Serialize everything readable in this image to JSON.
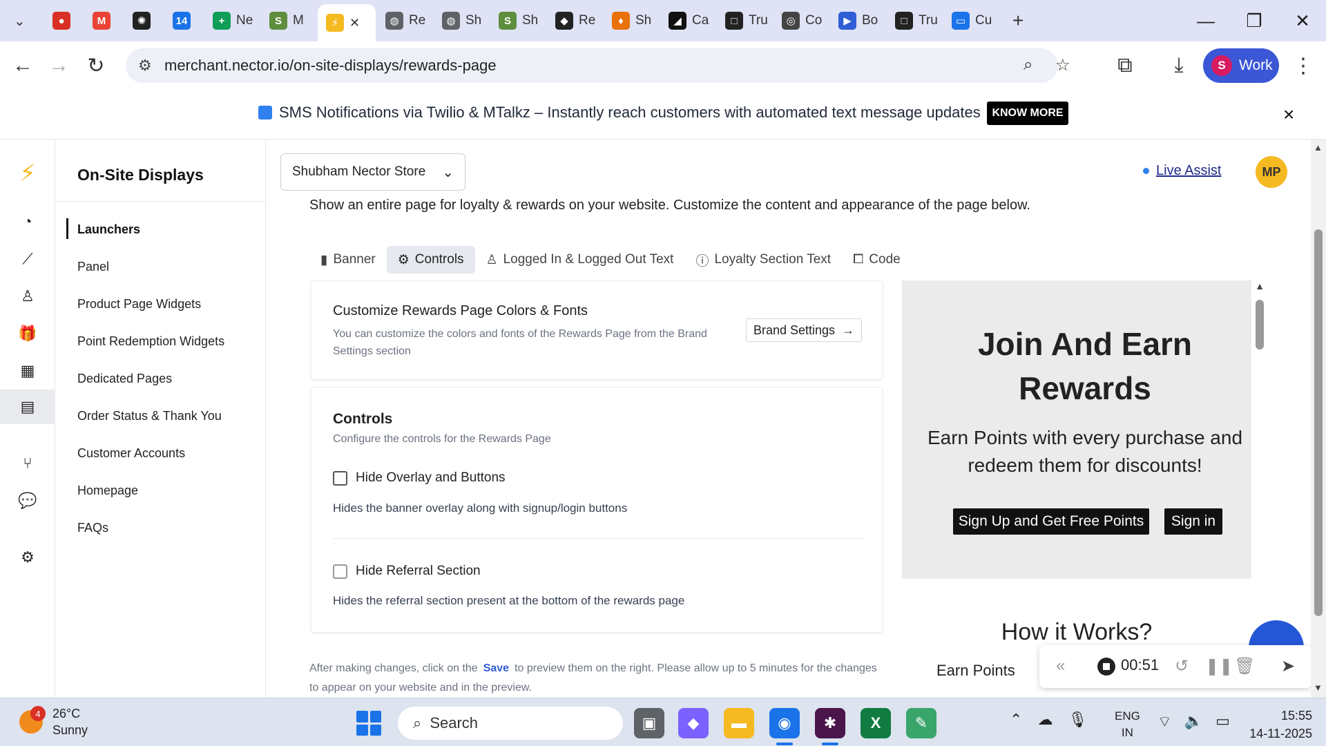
{
  "browser": {
    "tabs": [
      {
        "label": "",
        "icon": "record-icon",
        "color": "#d93025"
      },
      {
        "label": "",
        "icon": "gmail-icon",
        "color": "#ea4335"
      },
      {
        "label": "",
        "icon": "chatgpt-icon",
        "color": "#222222"
      },
      {
        "label": "",
        "icon": "calendar-icon",
        "color": "#1a73e8"
      },
      {
        "label": "Ne",
        "icon": "sheets-icon",
        "color": "#0f9d58"
      },
      {
        "label": "M",
        "icon": "shopify-icon",
        "color": "#5e8e3e"
      },
      {
        "label": "",
        "icon": "nector-icon",
        "color": "#f5b921"
      },
      {
        "label": "Re",
        "icon": "globe-icon",
        "color": "#5f6368"
      },
      {
        "label": "Sh",
        "icon": "globe-icon",
        "color": "#5f6368"
      },
      {
        "label": "Sh",
        "icon": "shopify-icon",
        "color": "#5e8e3e"
      },
      {
        "label": "Re",
        "icon": "diamond-icon",
        "color": "#222222"
      },
      {
        "label": "Sh",
        "icon": "flame-icon",
        "color": "#e8710a"
      },
      {
        "label": "Ca",
        "icon": "ca-icon",
        "color": "#111111"
      },
      {
        "label": "Tru",
        "icon": "square-icon",
        "color": "#222222"
      },
      {
        "label": "Co",
        "icon": "copilot-icon",
        "color": "#444444"
      },
      {
        "label": "Bo",
        "icon": "bo-icon",
        "color": "#2f5ed6"
      },
      {
        "label": "Tru",
        "icon": "square-icon",
        "color": "#222222"
      },
      {
        "label": "Cu",
        "icon": "cu-icon",
        "color": "#1a73e8"
      }
    ],
    "url": "merchant.nector.io/on-site-displays/rewards-page",
    "profile_initial": "S",
    "profile_label": "Work"
  },
  "announcement": {
    "text": "SMS Notifications via Twilio & MTalkz – Instantly reach customers with automated text message updates",
    "cta": "KNOW MORE",
    "close": "×"
  },
  "rail": [
    "dashboard-icon",
    "analytics-icon",
    "customers-icon",
    "rewards-icon",
    "widgets-icon",
    "displays-icon",
    "workflow-icon",
    "chat-icon",
    "settings-icon"
  ],
  "sidemenu": {
    "title": "On-Site Displays",
    "items": [
      "Launchers",
      "Panel",
      "Product Page Widgets",
      "Point Redemption Widgets",
      "Dedicated Pages",
      "Order Status & Thank You",
      "Customer Accounts",
      "Homepage",
      "FAQs"
    ]
  },
  "header": {
    "store": "Shubham Nector Store",
    "live_assist": "Live Assist",
    "user_initials": "MP"
  },
  "main": {
    "intro": "Show an entire page for loyalty & rewards on your website. Customize the content and appearance of the page below.",
    "tabs": [
      "Banner",
      "Controls",
      "Logged In & Logged Out Text",
      "Loyalty Section Text",
      "Code"
    ],
    "colors_card": {
      "title": "Customize Rewards Page Colors & Fonts",
      "desc": "You can customize the colors and fonts of the Rewards Page from the Brand Settings section",
      "button": "Brand Settings"
    },
    "controls_card": {
      "title": "Controls",
      "desc": "Configure the controls for the Rewards Page",
      "options": [
        {
          "label": "Hide Overlay and Buttons",
          "desc": "Hides the banner overlay along with signup/login buttons",
          "checked": false
        },
        {
          "label": "Hide Referral Section",
          "desc": "Hides the referral section present at the bottom of the rewards page",
          "checked": false
        }
      ]
    },
    "footnote_pre": "After making changes, click on the",
    "footnote_save": "Save",
    "footnote_post": "to preview them on the right. Please allow up to 5 minutes for the changes to appear on your website and in the preview."
  },
  "preview": {
    "title": "Join And Earn Rewards",
    "subtitle": "Earn Points with every purchase and redeem them for discounts!",
    "signup": "Sign Up and Get Free Points",
    "signin": "Sign in",
    "how_title": "How it Works?",
    "how_sub": "Earn Points",
    "how_sub2": "redeem them for discounts!"
  },
  "recorder": {
    "time": "00:51"
  },
  "taskbar": {
    "temp": "26°C",
    "condition": "Sunny",
    "notif_count": "4",
    "search": "Search",
    "lang1": "ENG",
    "lang2": "IN",
    "time": "15:55",
    "date": "14-11-2025"
  }
}
